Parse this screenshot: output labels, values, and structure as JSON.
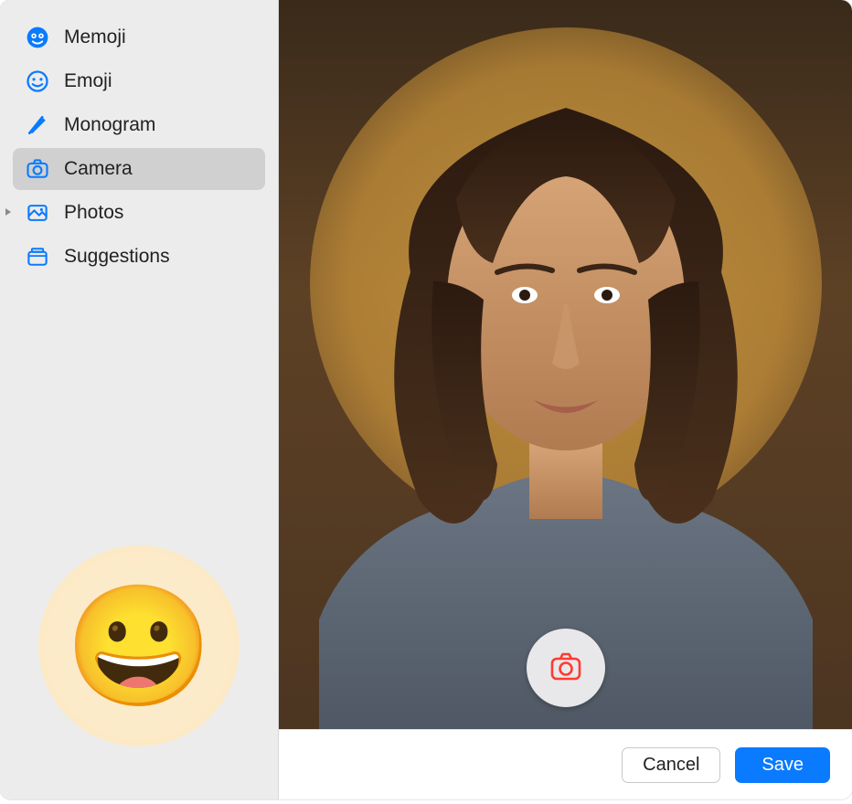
{
  "sidebar": {
    "items": [
      {
        "label": "Memoji",
        "icon": "memoji-icon",
        "selected": false,
        "disclosure": false
      },
      {
        "label": "Emoji",
        "icon": "emoji-icon",
        "selected": false,
        "disclosure": false
      },
      {
        "label": "Monogram",
        "icon": "monogram-icon",
        "selected": false,
        "disclosure": false
      },
      {
        "label": "Camera",
        "icon": "camera-icon",
        "selected": true,
        "disclosure": false
      },
      {
        "label": "Photos",
        "icon": "photos-icon",
        "selected": false,
        "disclosure": true
      },
      {
        "label": "Suggestions",
        "icon": "suggestions-icon",
        "selected": false,
        "disclosure": false
      }
    ],
    "current_picture_emoji": "😀"
  },
  "footer": {
    "cancel_label": "Cancel",
    "save_label": "Save"
  },
  "colors": {
    "accent": "#0a7aff",
    "sidebar_bg": "#ececec",
    "selected_bg": "#d0d0d0"
  }
}
